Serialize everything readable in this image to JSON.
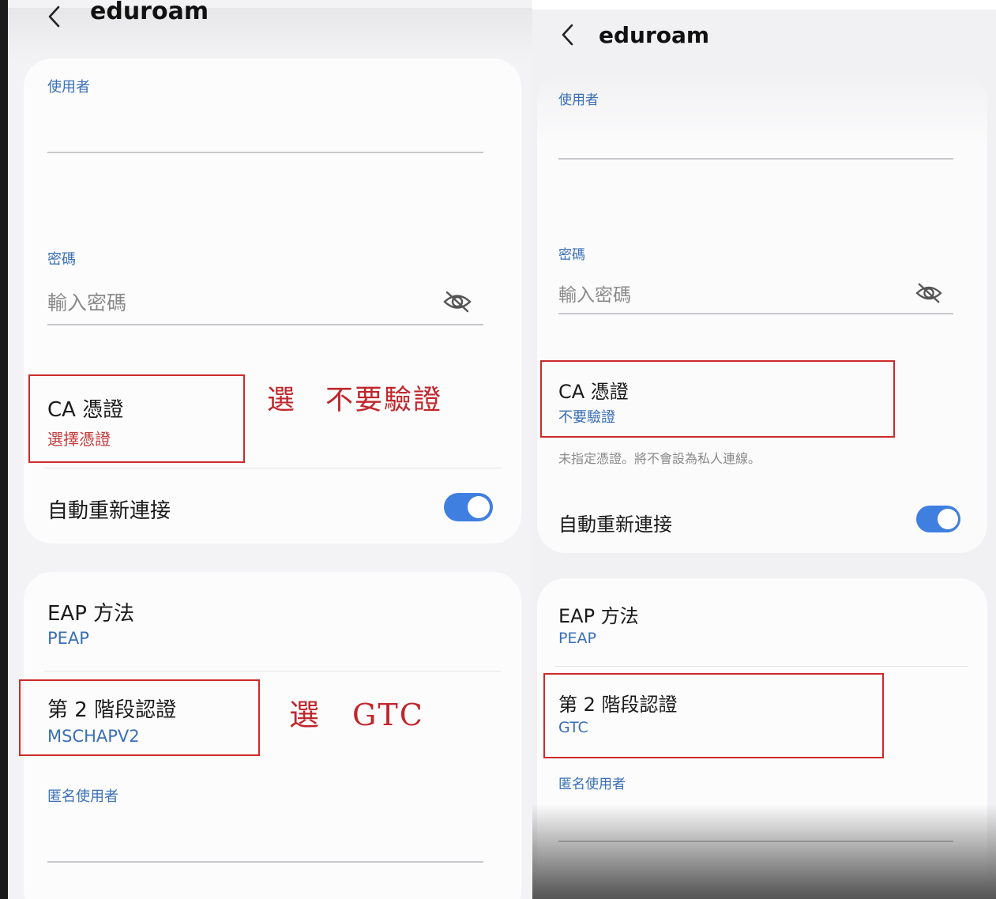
{
  "left": {
    "title": "eduroam",
    "identity_label": "使用者",
    "password_label": "密碼",
    "password_placeholder": "輸入密碼",
    "ca_cert_title": "CA 憑證",
    "ca_cert_value": "選擇憑證",
    "auto_reconnect": "自動重新連接",
    "eap_method_title": "EAP 方法",
    "eap_method_value": "PEAP",
    "phase2_title": "第 2 階段認證",
    "phase2_value": "MSCHAPV2",
    "anonymous_label": "匿名使用者",
    "annotation_ca": "選　不要驗證",
    "annotation_phase2": "選　GTC"
  },
  "right": {
    "title": "eduroam",
    "identity_label": "使用者",
    "password_label": "密碼",
    "password_placeholder": "輸入密碼",
    "ca_cert_title": "CA 憑證",
    "ca_cert_value": "不要驗證",
    "ca_cert_note": "未指定憑證。將不會設為私人連線。",
    "auto_reconnect": "自動重新連接",
    "eap_method_title": "EAP 方法",
    "eap_method_value": "PEAP",
    "phase2_title": "第 2 階段認證",
    "phase2_value": "GTC",
    "anonymous_label": "匿名使用者"
  },
  "colors": {
    "accent_blue": "#3a6fb5",
    "toggle_on": "#3f7fe0",
    "annotation_red": "#c0262b",
    "highlight_box": "#cc2b2b"
  },
  "icons": [
    "back-chevron-icon",
    "eye-off-icon"
  ]
}
